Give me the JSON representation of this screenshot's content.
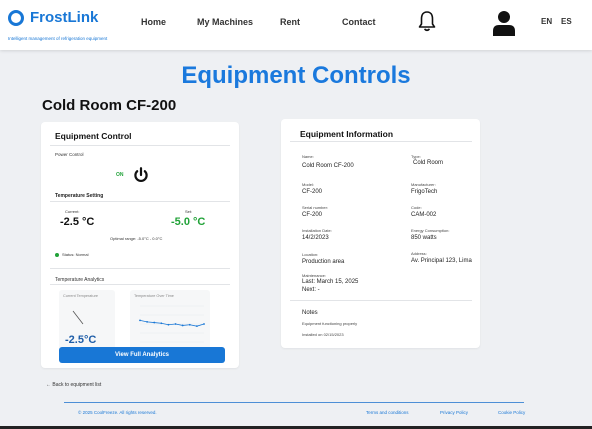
{
  "brand": {
    "name": "FrostLink",
    "tagline": "Intelligent management of refrigeration equipment",
    "color": "#1877d6"
  },
  "nav": {
    "items": [
      "Home",
      "My Machines",
      "Rent",
      "Contact"
    ],
    "notifications_icon": "bell-icon",
    "account_icon": "user-icon",
    "languages": [
      "EN",
      "ES"
    ]
  },
  "page": {
    "title": "Equipment Controls",
    "equipment_name": "Cold Room CF-200"
  },
  "control": {
    "title": "Equipment Control",
    "power": {
      "label": "Power Control",
      "state": "ON",
      "icon": "power-icon"
    },
    "temperature": {
      "label": "Temperature Setting",
      "current_label": "Current:",
      "current_value": "-2.5 °C",
      "set_label": "Set:",
      "set_value": "-5.0 °C",
      "optimal_range": "Optimal range: -5.0°C - 0.0°C"
    },
    "status": "Status: Normal",
    "analytics": {
      "title": "Temperature Analytics",
      "mini_label": "Current Temperature",
      "mini_value": "-2.5°C",
      "chart_title": "Temperature Over Time",
      "button": "View Full Analytics"
    }
  },
  "chart_data": {
    "type": "line",
    "title": "Temperature Over Time",
    "x": [
      1,
      2,
      3,
      4,
      5,
      6,
      7,
      8,
      9,
      10
    ],
    "series": [
      {
        "values": [
          -2.0,
          -2.2,
          -2.3,
          -2.4,
          -2.6,
          -2.5,
          -2.7,
          -2.6,
          -2.8,
          -2.5
        ]
      }
    ],
    "ylim": [
      -5,
      0
    ],
    "xlabel": "",
    "ylabel": ""
  },
  "info": {
    "title": "Equipment Information",
    "fields": [
      {
        "label": "Name:",
        "value": "Cold Room CF-200"
      },
      {
        "label": "Type:",
        "value": "Cold Room"
      },
      {
        "label": "Model:",
        "value": "CF-200"
      },
      {
        "label": "Manufacturer:",
        "value": "FrigoTech"
      },
      {
        "label": "Serial number:",
        "value": "CF-200"
      },
      {
        "label": "Code:",
        "value": "CAM-002"
      },
      {
        "label": "Installation Date:",
        "value": "14/2/2023"
      },
      {
        "label": "Energy Consumption:",
        "value": "850 watts"
      },
      {
        "label": "Location:",
        "value": "Production area"
      },
      {
        "label": "Address:",
        "value": "Av. Principal 123, Lima"
      }
    ],
    "maintenance": {
      "label": "Maintenance:",
      "last": "Last: March 15, 2025",
      "next": "Next: -"
    },
    "notes": {
      "title": "Notes",
      "lines": [
        "Equipment functioning properly",
        "Installed on 02/15/2023"
      ]
    }
  },
  "back_link": "← Back to equipment list",
  "footer": {
    "copyright": "© 2025 CoolFreeze. All rights reserved.",
    "links": [
      "Terms and conditions",
      "Privacy Policy",
      "Cookie Policy"
    ]
  }
}
